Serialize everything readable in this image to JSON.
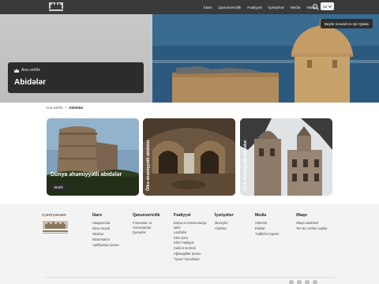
{
  "header": {
    "nav": [
      "İdarə",
      "Qanunvericilik",
      "Fəaliyyət",
      "İçərişəhər",
      "Media",
      "Əlaqə"
    ],
    "lang": "AZ"
  },
  "hero": {
    "badge": "Beylər məscidi və Qız Qalası",
    "home_label": "Ana səhifə",
    "title": "Abidələr"
  },
  "breadcrumb": {
    "home": "Ana səhifə",
    "sep": "/",
    "current": "Abidələr"
  },
  "cards": [
    {
      "title": "Dünya əhəmiyyətli abidələr",
      "button": "Ətraflı"
    },
    {
      "title": "Ölkə əhəmiyyətli abidələr"
    },
    {
      "title": "Yerli əhəmiyyətli abidələr"
    }
  ],
  "footer": {
    "logo_text": "İÇƏRİŞƏHƏR",
    "columns": [
      {
        "heading": "İdarə",
        "items": [
          "Haqqımızda",
          "İdarə Heyəti",
          "Struktur",
          "Nizamnamə",
          "Apellyasiya Şurası"
        ]
      },
      {
        "heading": "Qanunvericilik",
        "items": [
          "Fərmanlar və Sərəncamlar",
          "Qanunlar"
        ]
      },
      {
        "heading": "Fəaliyyət",
        "items": [
          "Bərpa və konservasiya işləri",
          "Layihələr",
          "Elmi Şura",
          "Elmi Fəaliyyət",
          "Xidmət mərkəzi",
          "Ağsaqqallar Şurası",
          "\"Qonu\" konulluları"
        ]
      },
      {
        "heading": "İçərişəhər",
        "items": [
          "Muzeylər",
          "Abidələr"
        ]
      },
      {
        "heading": "Media",
        "items": [
          "Xəbərlər",
          "Elanlar",
          "Tədbirlər təqvimi"
        ]
      },
      {
        "heading": "Əlaqə",
        "items": [
          "Əlaqə vasitələri",
          "Tez-tez verilən suallar"
        ]
      }
    ]
  },
  "colors": {
    "header_bg": "#3a3a3a",
    "title_card": "#2c2c2c",
    "footer_bg": "#f3f3f3"
  },
  "icons": [
    "logo-emblem",
    "search-icon",
    "chevron-down-icon",
    "home-crown-icon",
    "social-icons"
  ]
}
